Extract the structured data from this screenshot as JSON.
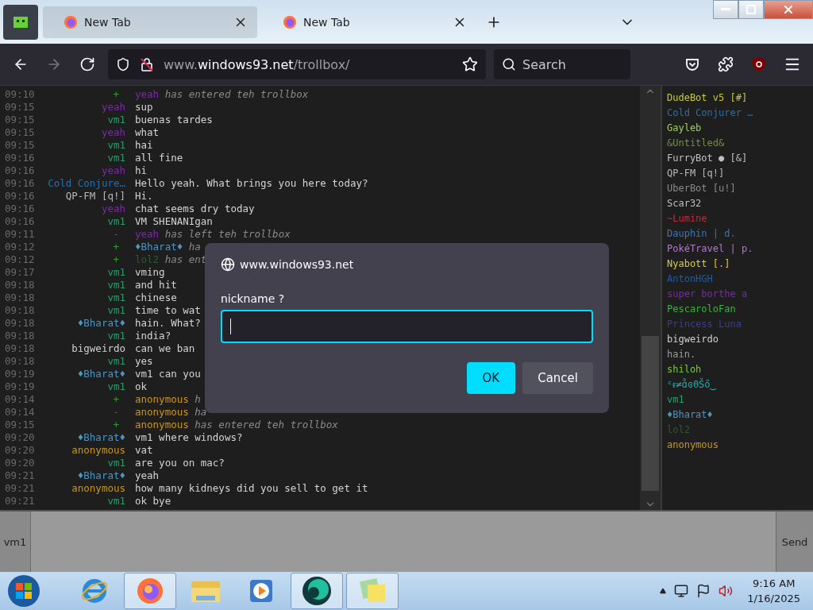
{
  "browser": {
    "tabs": [
      {
        "title": "New Tab",
        "selected": true
      },
      {
        "title": "New Tab",
        "selected": false
      }
    ],
    "url": {
      "host": "www.windows93.net",
      "path": "/trollbox/"
    },
    "search": {
      "placeholder": "Search"
    }
  },
  "chat": {
    "messages": [
      {
        "time": "09:10",
        "kind": "join",
        "marker": "+",
        "name": "yeah",
        "color": "#7a2aa8",
        "text": "has entered teh trollbox"
      },
      {
        "time": "09:15",
        "kind": "message",
        "name": "yeah",
        "color": "#7a2aa8",
        "text": "sup"
      },
      {
        "time": "09:15",
        "kind": "message",
        "name": "vm1",
        "color": "#2a9d6a",
        "text": "buenas tardes"
      },
      {
        "time": "09:15",
        "kind": "message",
        "name": "yeah",
        "color": "#7a2aa8",
        "text": "what"
      },
      {
        "time": "09:15",
        "kind": "message",
        "name": "vm1",
        "color": "#2a9d6a",
        "text": "hai"
      },
      {
        "time": "09:16",
        "kind": "message",
        "name": "vm1",
        "color": "#2a9d6a",
        "text": "all fine"
      },
      {
        "time": "09:16",
        "kind": "message",
        "name": "yeah",
        "color": "#7a2aa8",
        "text": "hi"
      },
      {
        "time": "09:16",
        "kind": "message",
        "name": "Cold Conjure…",
        "color": "#2a6fa8",
        "text": "Hello yeah. What brings you here today?"
      },
      {
        "time": "09:16",
        "kind": "message",
        "name": "QP-FM [q!]",
        "color": "#b8b8b8",
        "text": "Hi."
      },
      {
        "time": "09:16",
        "kind": "message",
        "name": "yeah",
        "color": "#7a2aa8",
        "text": "chat seems dry today"
      },
      {
        "time": "09:16",
        "kind": "message",
        "name": "vm1",
        "color": "#2a9d6a",
        "text": "VM SHENANIgan"
      },
      {
        "time": "09:11",
        "kind": "leave",
        "marker": "-",
        "name": "yeah",
        "color": "#7a2aa8",
        "text": "has left teh trollbox"
      },
      {
        "time": "09:12",
        "kind": "join",
        "marker": "+",
        "name": "♦Bharat♦",
        "color": "#4f93bd",
        "text": "ha"
      },
      {
        "time": "09:12",
        "kind": "join",
        "marker": "+",
        "name": "lol2",
        "color": "#2e5a32",
        "text": "has ent"
      },
      {
        "time": "09:17",
        "kind": "message",
        "name": "vm1",
        "color": "#2a9d6a",
        "text": "vming"
      },
      {
        "time": "09:18",
        "kind": "message",
        "name": "vm1",
        "color": "#2a9d6a",
        "text": "and hit"
      },
      {
        "time": "09:18",
        "kind": "message",
        "name": "vm1",
        "color": "#2a9d6a",
        "text": "chinese"
      },
      {
        "time": "09:18",
        "kind": "message",
        "name": "vm1",
        "color": "#2a9d6a",
        "text": "time to wat"
      },
      {
        "time": "09:18",
        "kind": "message",
        "name": "♦Bharat♦",
        "color": "#4f93bd",
        "text": "hain. What?"
      },
      {
        "time": "09:18",
        "kind": "message",
        "name": "vm1",
        "color": "#2a9d6a",
        "text": "india?"
      },
      {
        "time": "09:18",
        "kind": "message",
        "name": "bigweirdo",
        "color": "#d0d0d0",
        "text": "can we ban"
      },
      {
        "time": "09:18",
        "kind": "message",
        "name": "vm1",
        "color": "#2a9d6a",
        "text": "yes"
      },
      {
        "time": "09:19",
        "kind": "message",
        "name": "♦Bharat♦",
        "color": "#4f93bd",
        "text": "vm1 can you"
      },
      {
        "time": "09:19",
        "kind": "message",
        "name": "vm1",
        "color": "#2a9d6a",
        "text": "ok"
      },
      {
        "time": "09:14",
        "kind": "join",
        "marker": "+",
        "name": "anonymous",
        "color": "#c8961e",
        "text": "h"
      },
      {
        "time": "09:14",
        "kind": "leave",
        "marker": "-",
        "name": "anonymous",
        "color": "#c8961e",
        "text": "ha"
      },
      {
        "time": "09:15",
        "kind": "join",
        "marker": "+",
        "name": "anonymous",
        "color": "#c8961e",
        "text": "has entered teh trollbox"
      },
      {
        "time": "09:20",
        "kind": "message",
        "name": "♦Bharat♦",
        "color": "#4f93bd",
        "text": "vm1 where windows?"
      },
      {
        "time": "09:20",
        "kind": "message",
        "name": "anonymous",
        "color": "#c8961e",
        "text": "vat"
      },
      {
        "time": "09:20",
        "kind": "message",
        "name": "vm1",
        "color": "#2a9d6a",
        "text": "are you on mac?"
      },
      {
        "time": "09:21",
        "kind": "message",
        "name": "♦Bharat♦",
        "color": "#4f93bd",
        "text": "yeah"
      },
      {
        "time": "09:21",
        "kind": "message",
        "name": "anonymous",
        "color": "#c8961e",
        "text": "how many kidneys did you sell to get it"
      },
      {
        "time": "09:21",
        "kind": "message",
        "name": "vm1",
        "color": "#2a9d6a",
        "text": "ok bye"
      }
    ]
  },
  "users": [
    {
      "name": "DudeBot v5 [#]",
      "color": "#c8c83a"
    },
    {
      "name": "Cold Conjurer …",
      "color": "#2a6fa8"
    },
    {
      "name": "Gayleb",
      "color": "#9ccf5a"
    },
    {
      "name": "&Untitled&",
      "color": "#6f8f4a"
    },
    {
      "name": "FurryBot ● [&]",
      "color": "#c0c0c0"
    },
    {
      "name": "QP-FM [q!]",
      "color": "#b8b8b8"
    },
    {
      "name": "UberBot [u!]",
      "color": "#8a8a8a"
    },
    {
      "name": "Scar32",
      "color": "#bdbdbd"
    },
    {
      "name": "~Lumine",
      "color": "#c8283a"
    },
    {
      "name": "Dauphin | d.",
      "color": "#3a74c0"
    },
    {
      "name": "PokéTravel | p.",
      "color": "#b07ac8"
    },
    {
      "name": "Nyabott [.]",
      "color": "#d8c84a"
    },
    {
      "name": "AntonHGH",
      "color": "#245a9a"
    },
    {
      "name": "super borthe a",
      "color": "#7a2aa8"
    },
    {
      "name": "PescaroloFan",
      "color": "#3ab43a"
    },
    {
      "name": "Princess Luna",
      "color": "#3a3aa0"
    },
    {
      "name": "bigweirdo",
      "color": "#d0d0d0"
    },
    {
      "name": "hain.",
      "color": "#9a9a9a"
    },
    {
      "name": "shiloh",
      "color": "#7ac83a"
    },
    {
      "name": "ᶜᵲ≠ɑ̊ɞ0Šő‿",
      "color": "#20b0b0"
    },
    {
      "name": "vm1",
      "color": "#2a9d6a"
    },
    {
      "name": "♦Bharat♦",
      "color": "#4f93bd"
    },
    {
      "name": "lol2",
      "color": "#2e5a32"
    },
    {
      "name": "anonymous",
      "color": "#c8961e"
    }
  ],
  "composer": {
    "nick": "vm1",
    "send": "Send"
  },
  "dialog": {
    "origin": "www.windows93.net",
    "label": "nickname ?",
    "buttons": [
      {
        "label": "OK",
        "kind": "primary"
      },
      {
        "label": "Cancel",
        "kind": "secondary"
      }
    ]
  },
  "taskbar": {
    "apps": [
      {
        "kind": "ie",
        "open": false
      },
      {
        "kind": "firefox",
        "open": true
      },
      {
        "kind": "explorer",
        "open": false
      },
      {
        "kind": "media",
        "open": false
      },
      {
        "kind": "orb",
        "open": true
      },
      {
        "kind": "notes",
        "open": true
      }
    ],
    "time": "9:16 AM",
    "date": "1/16/2025"
  }
}
